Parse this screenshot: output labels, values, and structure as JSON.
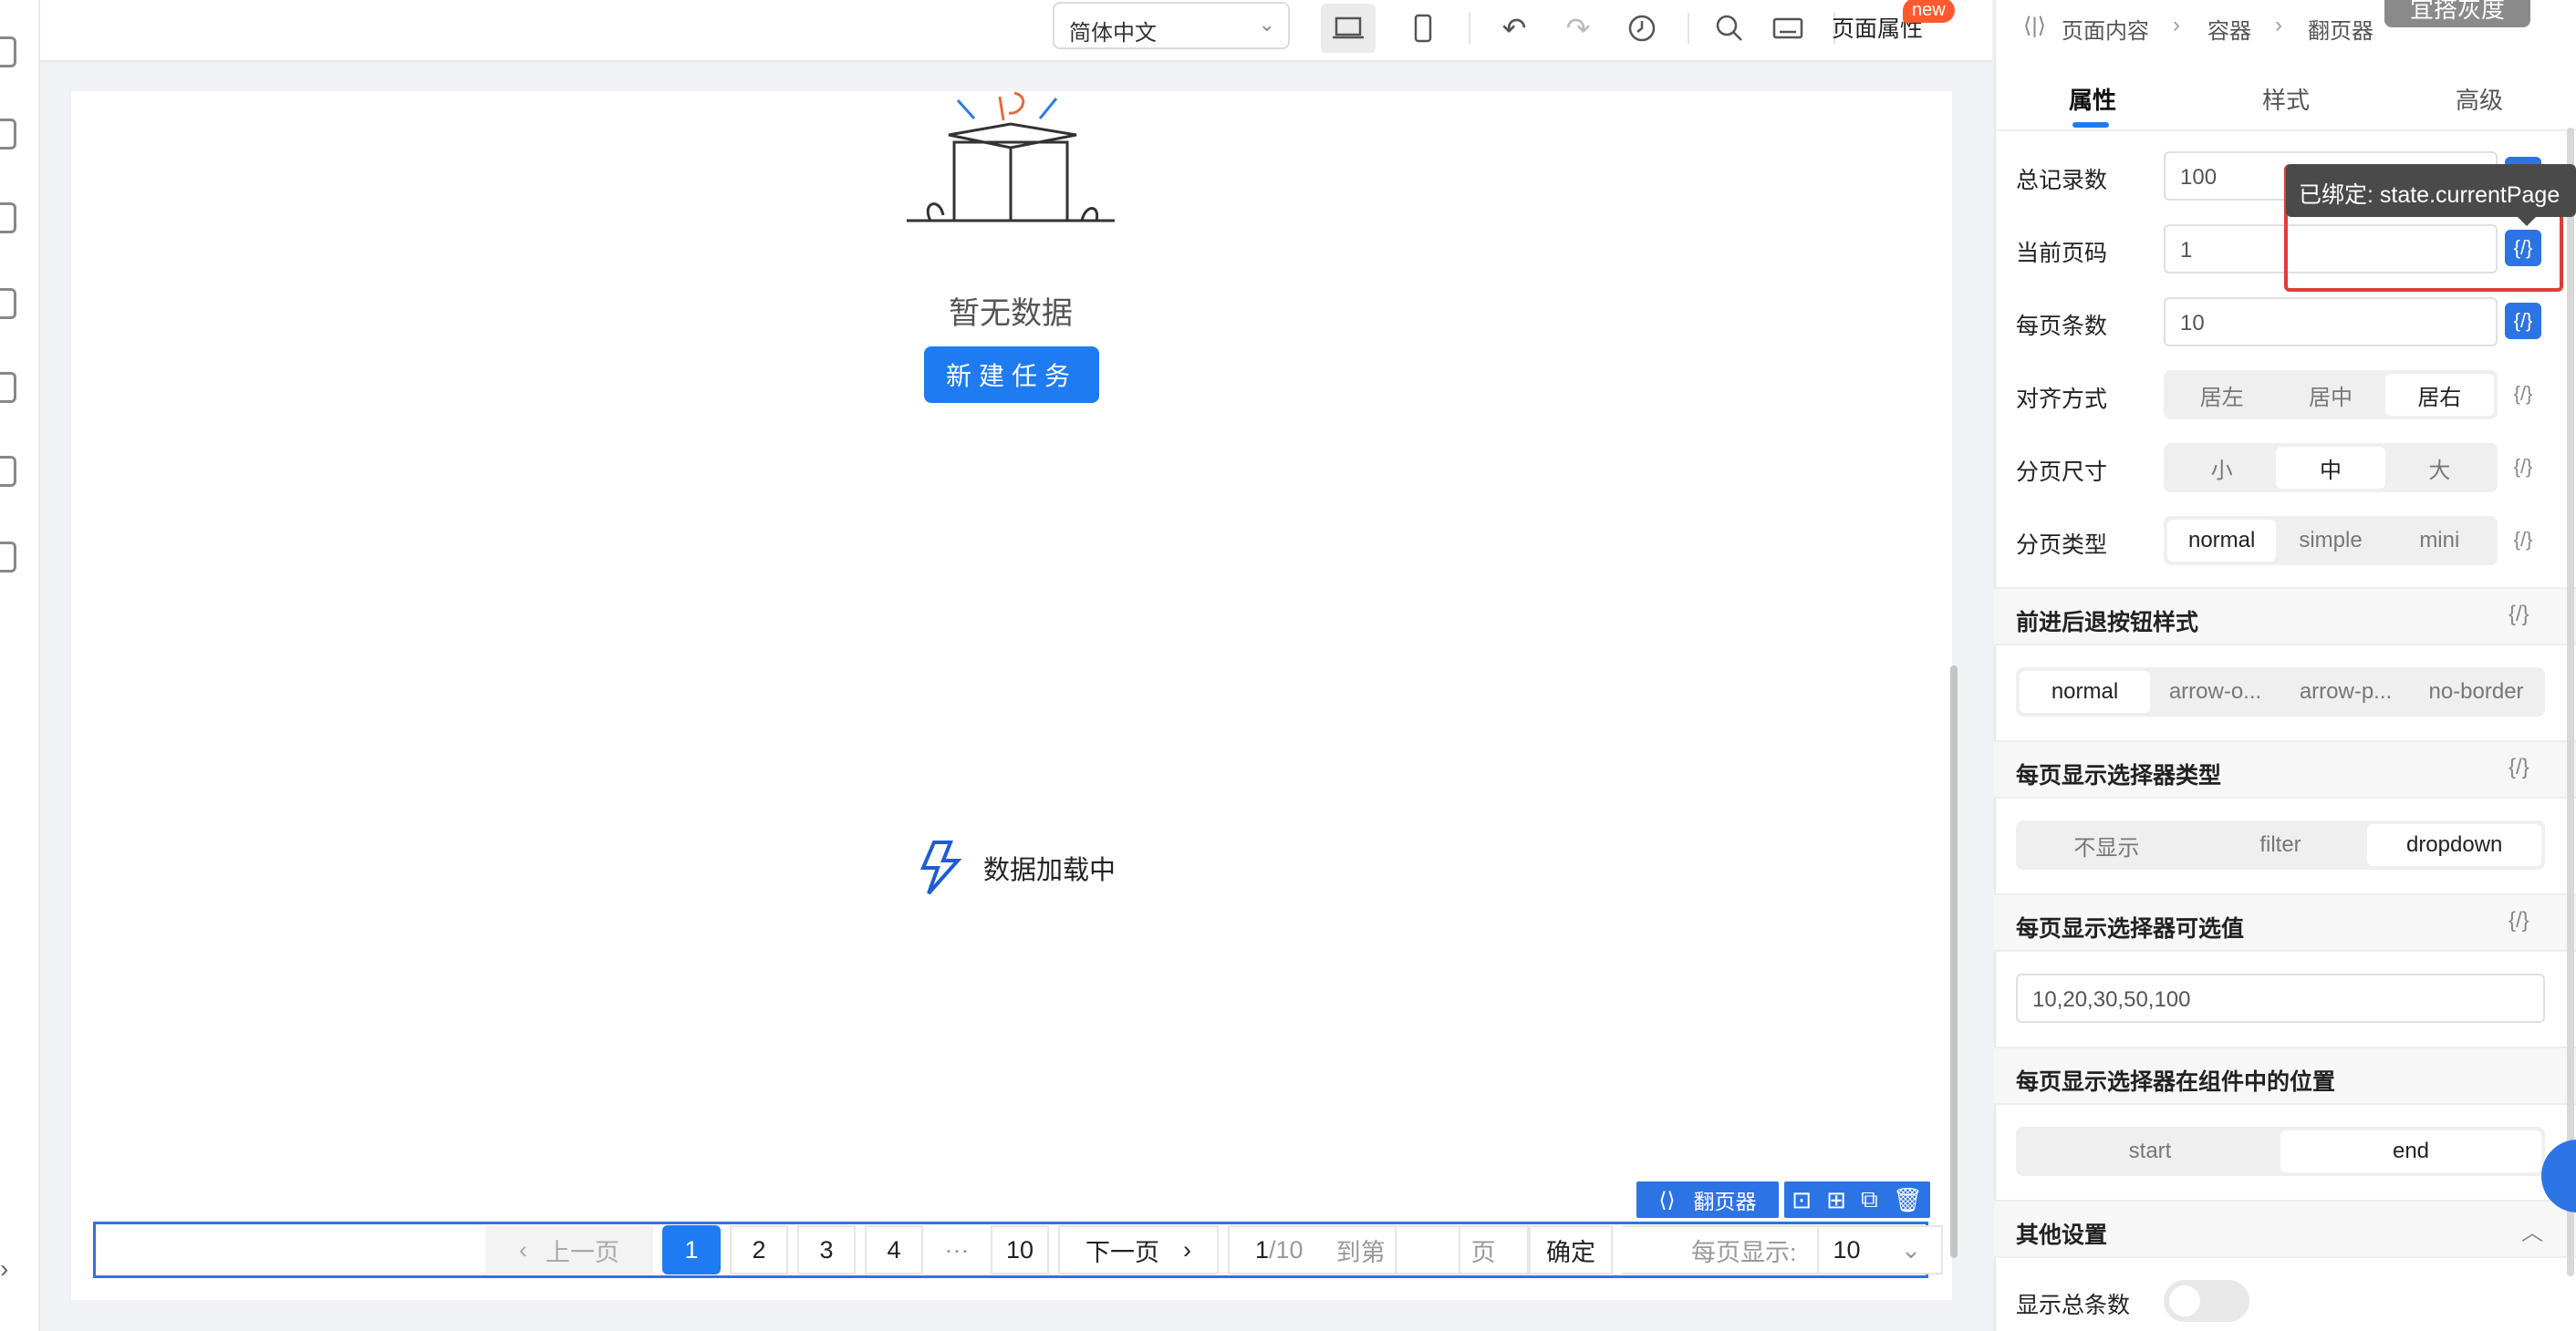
{
  "toolbar": {
    "language": "简体中文",
    "page_properties": "页面属性",
    "new_badge": "new"
  },
  "canvas": {
    "empty_text": "暂无数据",
    "new_task_button": "新建任务",
    "loading_text": "数据加载中"
  },
  "component_tag": {
    "label": "翻页器"
  },
  "pagination": {
    "prev": "上一页",
    "pages": [
      "1",
      "2",
      "3",
      "4"
    ],
    "ellipsis": "···",
    "last_page": "10",
    "next": "下一页",
    "current": "1",
    "total": "/10",
    "goto": "到第",
    "page_suffix": "页",
    "confirm": "确定",
    "page_size_label": "每页显示:",
    "page_size_value": "10"
  },
  "panel": {
    "breadcrumb": [
      "页面内容",
      "容器",
      "翻页器"
    ],
    "gray_button": "宜搭灰度",
    "tabs": [
      "属性",
      "样式",
      "高级"
    ],
    "fields": {
      "total_label": "总记录数",
      "total_value": "100",
      "current_label": "当前页码",
      "current_value": "1",
      "pagesize_label": "每页条数",
      "pagesize_value": "10",
      "align_label": "对齐方式",
      "align_options": [
        "居左",
        "居中",
        "居右"
      ],
      "size_label": "分页尺寸",
      "size_options": [
        "小",
        "中",
        "大"
      ],
      "type_label": "分页类型",
      "type_options": [
        "normal",
        "simple",
        "mini"
      ]
    },
    "bind_icon": "{/}",
    "tooltip": "已绑定: state.currentPage",
    "sections": {
      "nav_style": "前进后退按钮样式",
      "nav_style_options": [
        "normal",
        "arrow-o...",
        "arrow-p...",
        "no-border"
      ],
      "selector_type": "每页显示选择器类型",
      "selector_type_options": [
        "不显示",
        "filter",
        "dropdown"
      ],
      "selector_values": "每页显示选择器可选值",
      "selector_values_value": "10,20,30,50,100",
      "selector_position": "每页显示选择器在组件中的位置",
      "selector_position_options": [
        "start",
        "end"
      ],
      "other": "其他设置",
      "show_total": "显示总条数"
    }
  }
}
